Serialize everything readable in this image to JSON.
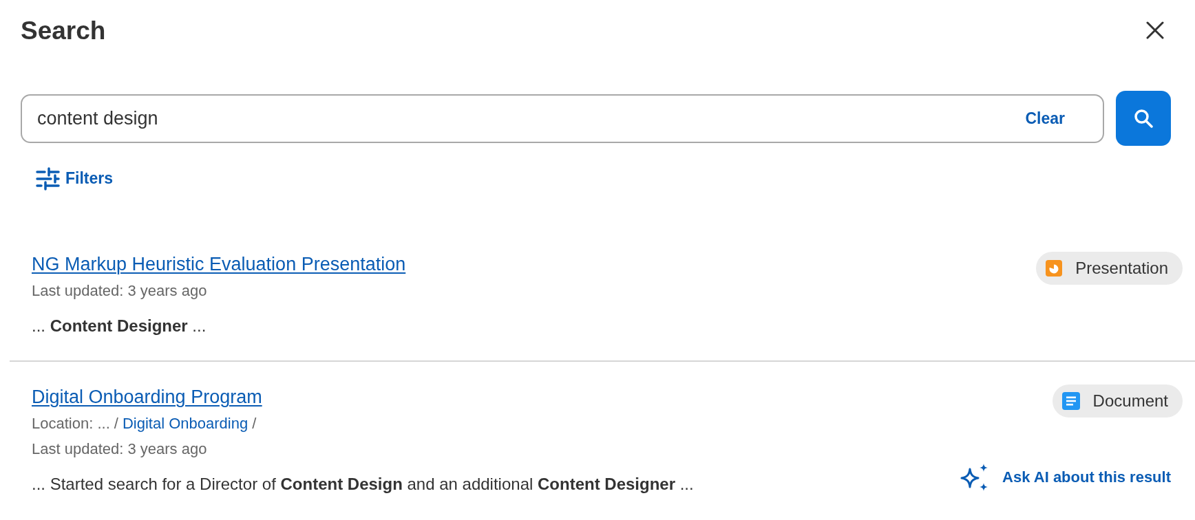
{
  "dialog": {
    "title": "Search"
  },
  "search": {
    "value": "content design",
    "clear_label": "Clear"
  },
  "filters": {
    "label": "Filters"
  },
  "results": [
    {
      "title": "NG Markup Heuristic Evaluation Presentation",
      "kind": "presentation",
      "type_label": "Presentation",
      "updated": "Last updated: 3 years ago",
      "snippet": "... **Content Designer** ..."
    },
    {
      "title": "Digital Onboarding Program",
      "kind": "document",
      "type_label": "Document",
      "location": {
        "prefix": "Location: ... /",
        "link": "Digital Onboarding",
        "suffix": "/"
      },
      "updated": "Last updated: 3 years ago",
      "snippet": "... Started search for a Director of **Content Design** and an additional **Content Designer** ...",
      "ask_ai": "Ask AI about this result"
    }
  ]
}
